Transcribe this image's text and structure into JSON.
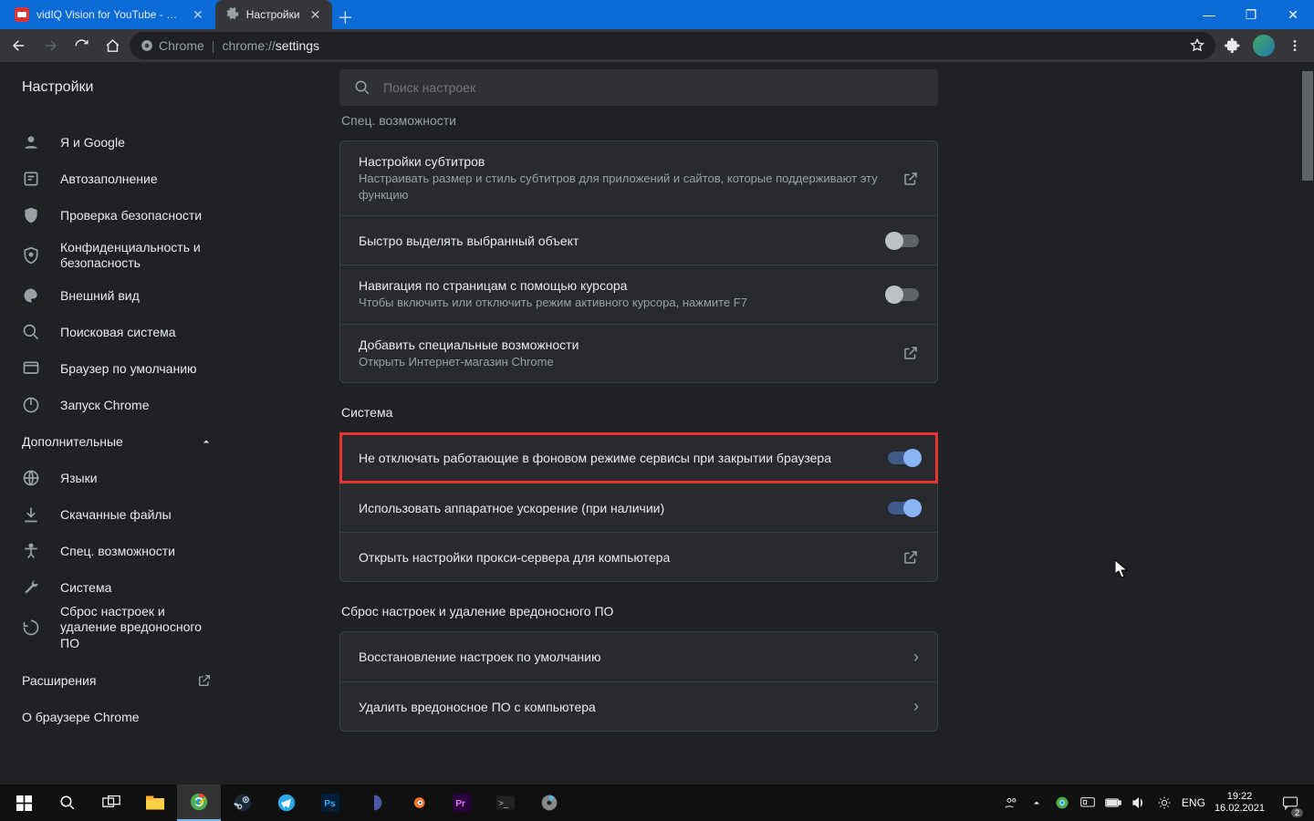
{
  "window": {
    "minimize": "—",
    "maximize": "❐",
    "close": "✕"
  },
  "tabs": {
    "inactive": {
      "title": "vidIQ Vision for YouTube - Инте"
    },
    "active": {
      "title": "Настройки"
    },
    "close_glyph": "✕",
    "new_glyph": "＋"
  },
  "omnibox": {
    "secure_label": "Chrome",
    "url_dim_prefix": "chrome://",
    "url_bright": "settings"
  },
  "settings_title": "Настройки",
  "search_placeholder": "Поиск настроек",
  "sidebar": {
    "items": [
      {
        "label": "Я и Google"
      },
      {
        "label": "Автозаполнение"
      },
      {
        "label": "Проверка безопасности"
      },
      {
        "label": "Конфиденциальность и безопасность"
      },
      {
        "label": "Внешний вид"
      },
      {
        "label": "Поисковая система"
      },
      {
        "label": "Браузер по умолчанию"
      },
      {
        "label": "Запуск Chrome"
      }
    ],
    "advanced_label": "Дополнительные",
    "advanced_items": [
      {
        "label": "Языки"
      },
      {
        "label": "Скачанные файлы"
      },
      {
        "label": "Спец. возможности"
      },
      {
        "label": "Система"
      },
      {
        "label": "Сброс настроек и удаление вредоносного ПО"
      }
    ],
    "extensions_label": "Расширения",
    "about_label": "О браузере Chrome"
  },
  "sections": {
    "accessibility_heading_cut": "Спец. возможности",
    "accessibility": [
      {
        "title": "Настройки субтитров",
        "sub": "Настраивать размер и стиль субтитров для приложений и сайтов, которые поддерживают эту функцию",
        "action": "external"
      },
      {
        "title": "Быстро выделять выбранный объект",
        "action": "toggle",
        "on": false
      },
      {
        "title": "Навигация по страницам с помощью курсора",
        "sub": "Чтобы включить или отключить режим активного курсора, нажмите F7",
        "action": "toggle",
        "on": false
      },
      {
        "title": "Добавить специальные возможности",
        "sub": "Открыть Интернет-магазин Chrome",
        "action": "external"
      }
    ],
    "system_heading": "Система",
    "system": [
      {
        "title": "Не отключать работающие в фоновом режиме сервисы при закрытии браузера",
        "action": "toggle",
        "on": true,
        "highlight": true
      },
      {
        "title": "Использовать аппаратное ускорение (при наличии)",
        "action": "toggle",
        "on": true
      },
      {
        "title": "Открыть настройки прокси-сервера для компьютера",
        "action": "external"
      }
    ],
    "reset_heading": "Сброс настроек и удаление вредоносного ПО",
    "reset": [
      {
        "title": "Восстановление настроек по умолчанию",
        "action": "chevron"
      },
      {
        "title": "Удалить вредоносное ПО с компьютера",
        "action": "chevron"
      }
    ]
  },
  "taskbar": {
    "lang": "ENG",
    "time": "19:22",
    "date": "16.02.2021",
    "notif_count": "2"
  }
}
